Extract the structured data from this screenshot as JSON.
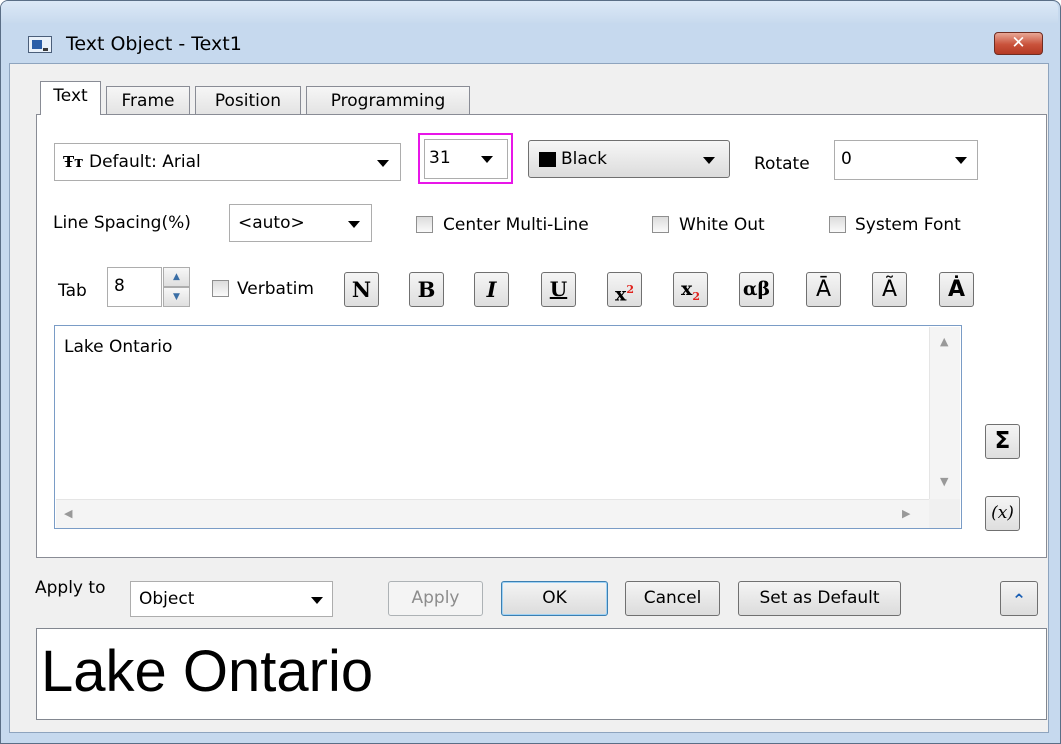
{
  "window": {
    "title": "Text Object - Text1",
    "close_glyph": "✕"
  },
  "tabs": [
    {
      "label": "Text",
      "active": true
    },
    {
      "label": "Frame",
      "active": false
    },
    {
      "label": "Position",
      "active": false
    },
    {
      "label": "Programming",
      "active": false
    }
  ],
  "font": {
    "icon_glyph": "Ŧт",
    "value": "Default: Arial"
  },
  "font_size": {
    "value": "31",
    "highlight_color": "#e816e8"
  },
  "color": {
    "value": "Black",
    "swatch": "#000000"
  },
  "rotate": {
    "label": "Rotate",
    "value": "0"
  },
  "line_spacing": {
    "label": "Line Spacing(%)",
    "value": "<auto>"
  },
  "checkboxes": {
    "center_multiline": {
      "label": "Center Multi-Line",
      "checked": false
    },
    "white_out": {
      "label": "White Out",
      "checked": false
    },
    "system_font": {
      "label": "System Font",
      "checked": false
    },
    "verbatim": {
      "label": "Verbatim",
      "checked": false
    }
  },
  "tab_field": {
    "label": "Tab",
    "value": "8"
  },
  "format_buttons": [
    {
      "name": "normal-button",
      "glyph": "N"
    },
    {
      "name": "bold-button",
      "glyph": "B"
    },
    {
      "name": "italic-button",
      "glyph": "I"
    },
    {
      "name": "underline-button",
      "glyph": "U"
    },
    {
      "name": "superscript-button",
      "glyph": "x"
    },
    {
      "name": "subscript-button",
      "glyph": "x"
    },
    {
      "name": "greek-button",
      "glyph": "αβ"
    },
    {
      "name": "overbar-button",
      "glyph": "Ā"
    },
    {
      "name": "tilde-button",
      "glyph": "Ã"
    },
    {
      "name": "dot-accent-button",
      "glyph": "Ȧ"
    }
  ],
  "superscript_mark": "2",
  "subscript_mark": "2",
  "editor": {
    "text": "Lake Ontario"
  },
  "side_buttons": {
    "sigma_glyph": "Σ",
    "variable_glyph": "(x)"
  },
  "apply_to": {
    "label": "Apply to",
    "value": "Object"
  },
  "buttons": {
    "apply": "Apply",
    "ok": "OK",
    "cancel": "Cancel",
    "set_default": "Set as Default",
    "collapse_glyph": "⌃"
  },
  "preview": {
    "text": "Lake Ontario"
  }
}
